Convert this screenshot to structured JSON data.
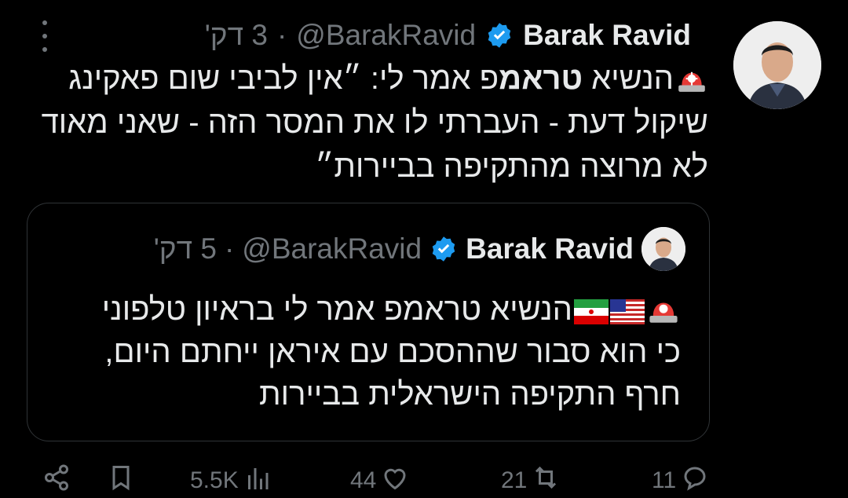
{
  "author": {
    "name": "Barak Ravid",
    "handle": "@BarakRavid",
    "separator": "·",
    "time": "3 דק'"
  },
  "tweet": {
    "line1_prefix": "הנשיא ",
    "line1_bold": "טראמ",
    "line1_rest": "פ אמר לי: ״אין לביבי שום פאקינג",
    "line2": "שיקול דעת - העברתי לו את המסר הזה - שאני מאוד",
    "line3": "לא מרוצה מהתקיפה בביירות״"
  },
  "quote": {
    "name": "Barak Ravid",
    "handle": "@BarakRavid",
    "separator": "·",
    "time": "5 דק'",
    "line1": "הנשיא טראמפ אמר לי בראיון טלפוני",
    "line2": "כי הוא סבור שההסכם עם איראן ייחתם היום,",
    "line3": "חרף התקיפה הישראלית בביירות"
  },
  "actions": {
    "replies": "11",
    "reposts": "21",
    "likes": "44",
    "views": "5.5K"
  },
  "colors": {
    "background": "#000000",
    "text": "#e7e9ea",
    "muted": "#71767b",
    "verified": "#1d9bf0",
    "border": "#2f3336"
  },
  "icons": [
    "more-icon",
    "verified-badge-icon",
    "siren-emoji",
    "us-flag-emoji",
    "iran-flag-emoji",
    "share-icon",
    "bookmark-icon",
    "views-icon",
    "like-icon",
    "repost-icon",
    "reply-icon"
  ]
}
